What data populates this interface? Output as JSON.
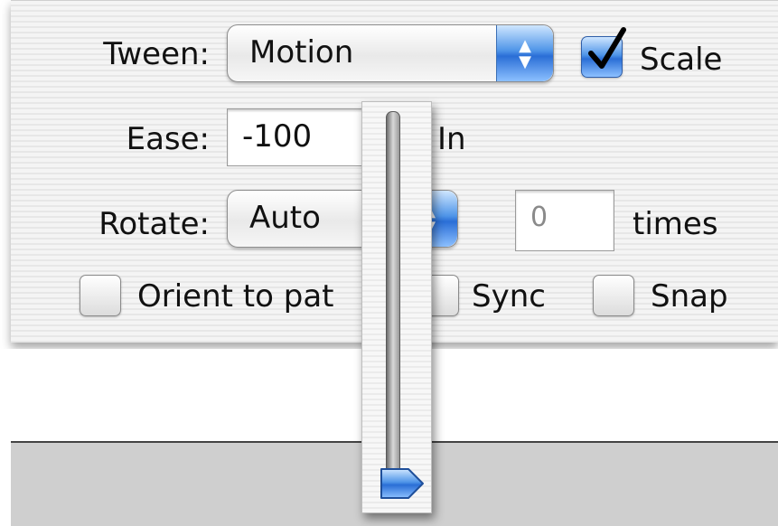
{
  "tween": {
    "label": "Tween:",
    "value": "Motion"
  },
  "scale": {
    "label": "Scale",
    "checked": true
  },
  "ease": {
    "label": "Ease:",
    "value": "-100",
    "suffix": "In"
  },
  "ease_slider": {
    "level_fraction": 0.0
  },
  "rotate": {
    "label": "Rotate:",
    "value": "Auto",
    "times_value": "0",
    "times_label": "times"
  },
  "options": {
    "orient_label": "Orient to pat",
    "orient_checked": false,
    "sync_label": "Sync",
    "sync_checked": false,
    "snap_label": "Snap",
    "snap_checked": false
  },
  "colors": {
    "accent": "#3d86e6",
    "panel": "#f1f1f1"
  },
  "icons": {
    "popup_arrows": "updown-chevron-icon",
    "checkmark": "checkmark-icon"
  }
}
